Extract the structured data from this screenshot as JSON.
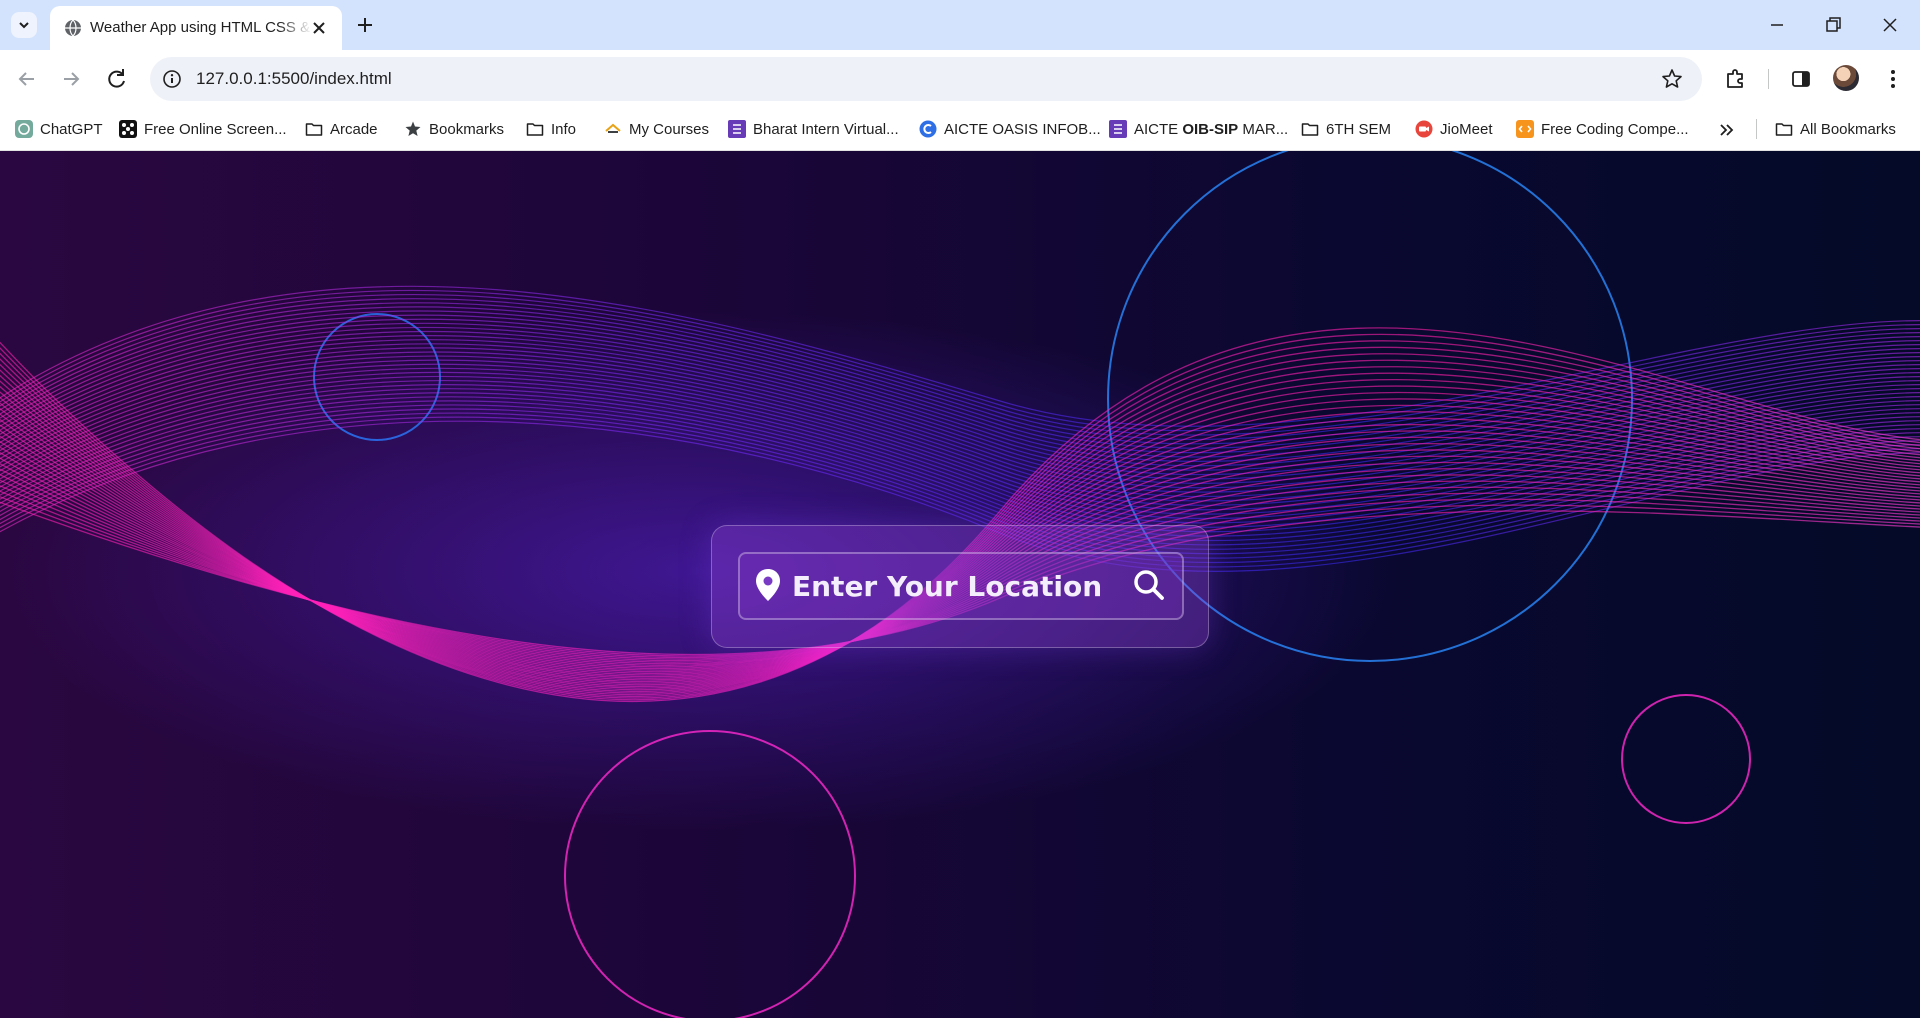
{
  "browser": {
    "tab": {
      "title": "Weather App using HTML CSS & JavaScript"
    },
    "address": {
      "url": "127.0.0.1:5500/index.html"
    },
    "bookmarks": [
      {
        "label": "ChatGPT",
        "icon": "chatgpt-icon"
      },
      {
        "label": "Free Online Screen...",
        "icon": "screen-recorder-icon"
      },
      {
        "label": "Arcade",
        "icon": "folder-icon"
      },
      {
        "label": "Bookmarks",
        "icon": "star-icon"
      },
      {
        "label": "Info",
        "icon": "folder-icon"
      },
      {
        "label": "My Courses",
        "icon": "courses-icon"
      },
      {
        "label": "Bharat Intern Virtual...",
        "icon": "form-icon"
      },
      {
        "label": "AICTE OASIS INFOB...",
        "icon": "chrome-c-icon"
      },
      {
        "label_prefix": "AICTE ",
        "label_bold": "OIB-SIP",
        "label_suffix": " MAR...",
        "icon": "form-icon"
      },
      {
        "label": "6TH SEM",
        "icon": "folder-icon"
      },
      {
        "label": "JioMeet",
        "icon": "jiomeet-icon"
      },
      {
        "label": "Free Coding Compe...",
        "icon": "coding-icon"
      }
    ],
    "all_bookmarks_label": "All Bookmarks"
  },
  "app": {
    "search": {
      "placeholder": "Enter Your Location"
    }
  },
  "colors": {
    "accent_magenta": "#ff2bd0",
    "accent_blue": "#2a7bff",
    "card_glass": "#9646dc"
  }
}
